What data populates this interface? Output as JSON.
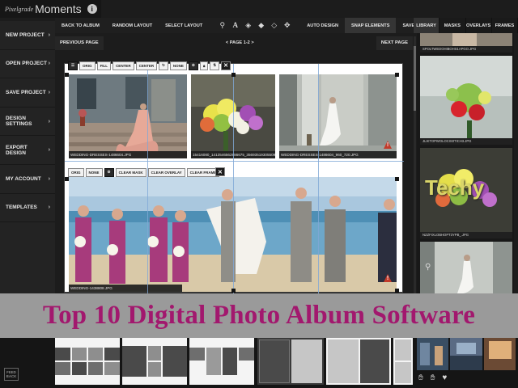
{
  "brand": {
    "small": "Pixelgrade",
    "big": "Moments",
    "info_icon": "info-icon"
  },
  "sidebar": {
    "items": [
      {
        "label": "NEW PROJECT"
      },
      {
        "label": "OPEN PROJECT"
      },
      {
        "label": "SAVE PROJECT"
      },
      {
        "label": "DESIGN SETTINGS"
      },
      {
        "label": "EXPORT DESIGN"
      },
      {
        "label": "MY ACCOUNT"
      },
      {
        "label": "TEMPLATES"
      }
    ],
    "chevron": "›"
  },
  "toolbar": {
    "back_to_album": "BACK TO ALBUM",
    "random_layout": "RANDOM LAYOUT",
    "select_layout": "SELECT LAYOUT",
    "auto_design": "AUTO DESIGN",
    "snap_elements": "SNAP ELEMENTS",
    "save_as_template": "SAVE AS TEMPLATE",
    "icons": [
      "link-icon",
      "text-icon",
      "layers-icon",
      "bring-forward-icon",
      "send-backward-icon",
      "move-icon"
    ]
  },
  "subbar": {
    "previous": "PREVIOUS PAGE",
    "page": "< PAGE 1-2 >",
    "next": "NEXT PAGE"
  },
  "frame_tools_top": [
    "ORIG",
    "FILL",
    "CENTER",
    "CENTER",
    "NONE"
  ],
  "frame_tools_bottom": [
    "ORIG",
    "NONE",
    "CLEAR MASK",
    "CLEAR OVERLAY",
    "CLEAR FRAME"
  ],
  "photos": {
    "p1_caption": "WEDDING-DRESSES-1486604.JPG",
    "p2_caption": "15416080_1413546562886675_3569351930550975_N.JPG",
    "p3_caption": "WEDDING-DRESSES-1486604_960_720.JPG",
    "p4_caption": "WEDDING-1438808.JPG"
  },
  "right_tabs": [
    "LIBRARY",
    "MASKS",
    "OVERLAYS",
    "FRAMES"
  ],
  "library": {
    "items": [
      {
        "caption": "SPOLTWEDOHIBOHS1APGO.JPG"
      },
      {
        "caption": "JLIKTOPWOLOCIS0TICH3.JPG"
      },
      {
        "caption": "NZZFIXLOBHOPT3YPB_.JPG"
      }
    ]
  },
  "watermark": "Techy",
  "banner": {
    "title": "Top 10 Digital Photo Album Software"
  },
  "feedback": {
    "line1": "FEED",
    "line2": "BACK"
  },
  "colors": {
    "accent": "#a2186e",
    "bg": "#1c1c1c",
    "banner": "#9a9a9a"
  }
}
